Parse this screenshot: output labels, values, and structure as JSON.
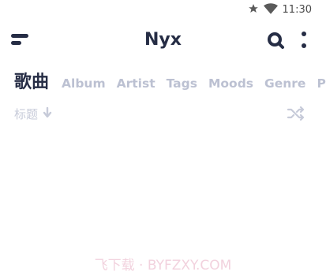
{
  "status": {
    "time": "11:30",
    "icons": [
      "star-icon",
      "wifi-icon"
    ]
  },
  "app": {
    "title": "Nyx"
  },
  "tabs": [
    {
      "label": "歌曲",
      "active": true
    },
    {
      "label": "Album"
    },
    {
      "label": "Artist"
    },
    {
      "label": "Tags"
    },
    {
      "label": "Moods"
    },
    {
      "label": "Genre"
    },
    {
      "label": "P"
    }
  ],
  "sort": {
    "label": "标题",
    "direction": "down"
  },
  "watermark": "飞下载 · BYFZXY.COM",
  "colors": {
    "primary": "#262d45",
    "inactive": "#bcc1d2",
    "muted": "#c7cbd9",
    "watermark": "#f2d2de"
  }
}
